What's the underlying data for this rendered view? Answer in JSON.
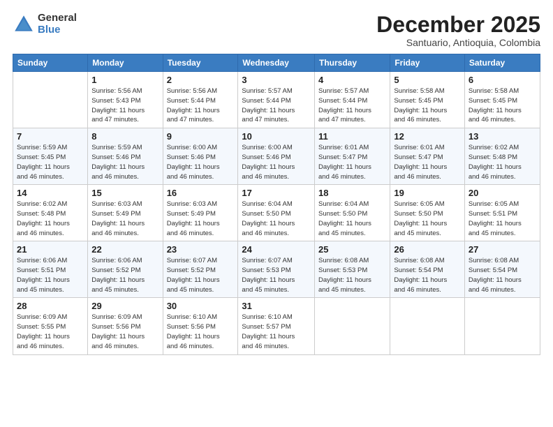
{
  "logo": {
    "general": "General",
    "blue": "Blue"
  },
  "title": "December 2025",
  "subtitle": "Santuario, Antioquia, Colombia",
  "days_header": [
    "Sunday",
    "Monday",
    "Tuesday",
    "Wednesday",
    "Thursday",
    "Friday",
    "Saturday"
  ],
  "weeks": [
    [
      {
        "day": "",
        "info": ""
      },
      {
        "day": "1",
        "info": "Sunrise: 5:56 AM\nSunset: 5:43 PM\nDaylight: 11 hours\nand 47 minutes."
      },
      {
        "day": "2",
        "info": "Sunrise: 5:56 AM\nSunset: 5:44 PM\nDaylight: 11 hours\nand 47 minutes."
      },
      {
        "day": "3",
        "info": "Sunrise: 5:57 AM\nSunset: 5:44 PM\nDaylight: 11 hours\nand 47 minutes."
      },
      {
        "day": "4",
        "info": "Sunrise: 5:57 AM\nSunset: 5:44 PM\nDaylight: 11 hours\nand 47 minutes."
      },
      {
        "day": "5",
        "info": "Sunrise: 5:58 AM\nSunset: 5:45 PM\nDaylight: 11 hours\nand 46 minutes."
      },
      {
        "day": "6",
        "info": "Sunrise: 5:58 AM\nSunset: 5:45 PM\nDaylight: 11 hours\nand 46 minutes."
      }
    ],
    [
      {
        "day": "7",
        "info": "Sunrise: 5:59 AM\nSunset: 5:45 PM\nDaylight: 11 hours\nand 46 minutes."
      },
      {
        "day": "8",
        "info": "Sunrise: 5:59 AM\nSunset: 5:46 PM\nDaylight: 11 hours\nand 46 minutes."
      },
      {
        "day": "9",
        "info": "Sunrise: 6:00 AM\nSunset: 5:46 PM\nDaylight: 11 hours\nand 46 minutes."
      },
      {
        "day": "10",
        "info": "Sunrise: 6:00 AM\nSunset: 5:46 PM\nDaylight: 11 hours\nand 46 minutes."
      },
      {
        "day": "11",
        "info": "Sunrise: 6:01 AM\nSunset: 5:47 PM\nDaylight: 11 hours\nand 46 minutes."
      },
      {
        "day": "12",
        "info": "Sunrise: 6:01 AM\nSunset: 5:47 PM\nDaylight: 11 hours\nand 46 minutes."
      },
      {
        "day": "13",
        "info": "Sunrise: 6:02 AM\nSunset: 5:48 PM\nDaylight: 11 hours\nand 46 minutes."
      }
    ],
    [
      {
        "day": "14",
        "info": "Sunrise: 6:02 AM\nSunset: 5:48 PM\nDaylight: 11 hours\nand 46 minutes."
      },
      {
        "day": "15",
        "info": "Sunrise: 6:03 AM\nSunset: 5:49 PM\nDaylight: 11 hours\nand 46 minutes."
      },
      {
        "day": "16",
        "info": "Sunrise: 6:03 AM\nSunset: 5:49 PM\nDaylight: 11 hours\nand 46 minutes."
      },
      {
        "day": "17",
        "info": "Sunrise: 6:04 AM\nSunset: 5:50 PM\nDaylight: 11 hours\nand 46 minutes."
      },
      {
        "day": "18",
        "info": "Sunrise: 6:04 AM\nSunset: 5:50 PM\nDaylight: 11 hours\nand 45 minutes."
      },
      {
        "day": "19",
        "info": "Sunrise: 6:05 AM\nSunset: 5:50 PM\nDaylight: 11 hours\nand 45 minutes."
      },
      {
        "day": "20",
        "info": "Sunrise: 6:05 AM\nSunset: 5:51 PM\nDaylight: 11 hours\nand 45 minutes."
      }
    ],
    [
      {
        "day": "21",
        "info": "Sunrise: 6:06 AM\nSunset: 5:51 PM\nDaylight: 11 hours\nand 45 minutes."
      },
      {
        "day": "22",
        "info": "Sunrise: 6:06 AM\nSunset: 5:52 PM\nDaylight: 11 hours\nand 45 minutes."
      },
      {
        "day": "23",
        "info": "Sunrise: 6:07 AM\nSunset: 5:52 PM\nDaylight: 11 hours\nand 45 minutes."
      },
      {
        "day": "24",
        "info": "Sunrise: 6:07 AM\nSunset: 5:53 PM\nDaylight: 11 hours\nand 45 minutes."
      },
      {
        "day": "25",
        "info": "Sunrise: 6:08 AM\nSunset: 5:53 PM\nDaylight: 11 hours\nand 45 minutes."
      },
      {
        "day": "26",
        "info": "Sunrise: 6:08 AM\nSunset: 5:54 PM\nDaylight: 11 hours\nand 46 minutes."
      },
      {
        "day": "27",
        "info": "Sunrise: 6:08 AM\nSunset: 5:54 PM\nDaylight: 11 hours\nand 46 minutes."
      }
    ],
    [
      {
        "day": "28",
        "info": "Sunrise: 6:09 AM\nSunset: 5:55 PM\nDaylight: 11 hours\nand 46 minutes."
      },
      {
        "day": "29",
        "info": "Sunrise: 6:09 AM\nSunset: 5:56 PM\nDaylight: 11 hours\nand 46 minutes."
      },
      {
        "day": "30",
        "info": "Sunrise: 6:10 AM\nSunset: 5:56 PM\nDaylight: 11 hours\nand 46 minutes."
      },
      {
        "day": "31",
        "info": "Sunrise: 6:10 AM\nSunset: 5:57 PM\nDaylight: 11 hours\nand 46 minutes."
      },
      {
        "day": "",
        "info": ""
      },
      {
        "day": "",
        "info": ""
      },
      {
        "day": "",
        "info": ""
      }
    ]
  ]
}
